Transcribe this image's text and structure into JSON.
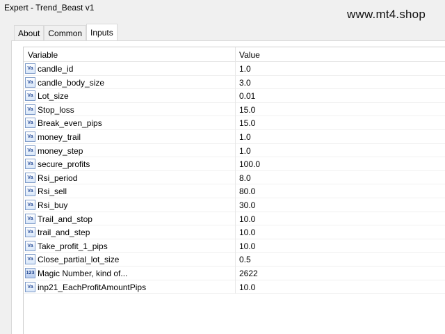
{
  "window": {
    "title": "Expert - Trend_Beast v1",
    "watermark": "www.mt4.shop"
  },
  "tabs": [
    {
      "label": "About",
      "active": false
    },
    {
      "label": "Common",
      "active": false
    },
    {
      "label": "Inputs",
      "active": true
    }
  ],
  "table": {
    "headers": {
      "variable": "Variable",
      "value": "Value"
    },
    "rows": [
      {
        "name": "candle_id",
        "value": "1.0",
        "icon": "variable-icon"
      },
      {
        "name": "candle_body_size",
        "value": "3.0",
        "icon": "variable-icon"
      },
      {
        "name": "Lot_size",
        "value": "0.01",
        "icon": "variable-icon"
      },
      {
        "name": "Stop_loss",
        "value": "15.0",
        "icon": "variable-icon"
      },
      {
        "name": "Break_even_pips",
        "value": "15.0",
        "icon": "variable-icon"
      },
      {
        "name": "money_trail",
        "value": "1.0",
        "icon": "variable-icon"
      },
      {
        "name": "money_step",
        "value": "1.0",
        "icon": "variable-icon"
      },
      {
        "name": "secure_profits",
        "value": "100.0",
        "icon": "variable-icon"
      },
      {
        "name": "Rsi_period",
        "value": "8.0",
        "icon": "variable-icon"
      },
      {
        "name": "Rsi_sell",
        "value": "80.0",
        "icon": "variable-icon"
      },
      {
        "name": "Rsi_buy",
        "value": "30.0",
        "icon": "variable-icon"
      },
      {
        "name": "Trail_and_stop",
        "value": "10.0",
        "icon": "variable-icon"
      },
      {
        "name": "trail_and_step",
        "value": "10.0",
        "icon": "variable-icon"
      },
      {
        "name": "Take_profit_1_pips",
        "value": "10.0",
        "icon": "variable-icon"
      },
      {
        "name": "Close_partial_lot_size",
        "value": "0.5",
        "icon": "variable-icon"
      },
      {
        "name": "Magic Number, kind of...",
        "value": "2622",
        "icon": "integer-icon"
      },
      {
        "name": "inp21_EachProfitAmountPips",
        "value": "10.0",
        "icon": "variable-icon"
      }
    ]
  }
}
